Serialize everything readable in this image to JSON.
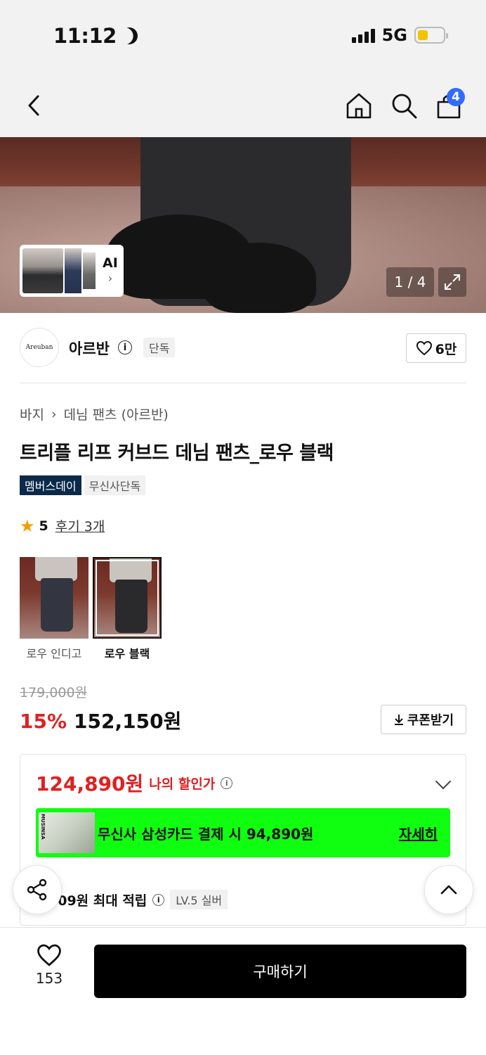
{
  "status_bar": {
    "time": "11:12",
    "network": "5G"
  },
  "nav": {
    "cart_count": "4"
  },
  "hero": {
    "ai_label": "AI",
    "counter": "1 / 4"
  },
  "brand": {
    "logo_text": "Areuban",
    "name": "아르반",
    "tag": "단독",
    "likes": "6만"
  },
  "breadcrumb": {
    "category": "바지",
    "subcategory": "데님 팬츠 (아르반)"
  },
  "product": {
    "title": "트리플 리프 커브드 데님 팬츠_로우 블랙",
    "tags": [
      "멤버스데이",
      "무신사단독"
    ],
    "rating": "5",
    "review_link": "후기 3개"
  },
  "variants": [
    {
      "label": "로우 인디고",
      "selected": false
    },
    {
      "label": "로우 블랙",
      "selected": true
    }
  ],
  "price": {
    "original": "179,000원",
    "discount": "15%",
    "sale": "152,150원",
    "coupon_label": "쿠폰받기"
  },
  "benefits": {
    "my_price": "124,890원",
    "my_price_label": "나의 할인가",
    "card_brand": "MUSINSA",
    "card_text": "무신사 삼성카드 결제 시 94,890원",
    "card_detail": "자세히",
    "points_text": "009원 최대 적립",
    "level": "LV.5 실버"
  },
  "bottom": {
    "like_count": "153",
    "buy_label": "구매하기"
  },
  "colors": {
    "discount_red": "#e02020",
    "card_green": "#10ff10",
    "tag_navy": "#0b2a4a",
    "badge_blue": "#2f6bff"
  }
}
